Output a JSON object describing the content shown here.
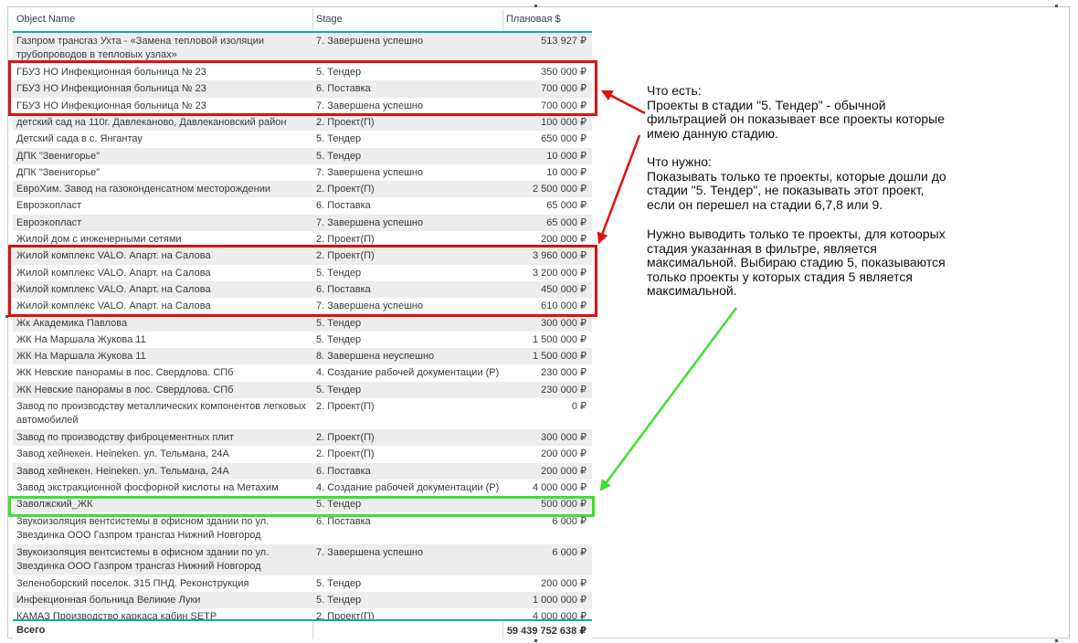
{
  "table": {
    "columns": [
      "Object Name",
      "Stage",
      "Плановая $"
    ],
    "rows": [
      {
        "name": "Газпром трансгаз Ухта - «Замена тепловой изоляции трубопроводов в тепловых узлах»",
        "stage": "7. Завершена успешно",
        "amount": "513 927 ₽"
      },
      {
        "name": "ГБУЗ НО Инфекционная больница № 23",
        "stage": "5. Тендер",
        "amount": "350 000 ₽"
      },
      {
        "name": "ГБУЗ НО Инфекционная больница № 23",
        "stage": "6. Поставка",
        "amount": "700 000 ₽"
      },
      {
        "name": "ГБУЗ НО Инфекционная больница № 23",
        "stage": "7. Завершена успешно",
        "amount": "700 000 ₽"
      },
      {
        "name": "детский сад на 110г. Давлеканово, Давлекановский район",
        "stage": "2. Проект(П)",
        "amount": "100 000 ₽"
      },
      {
        "name": "Детский сада в с. Янгантау",
        "stage": "5. Тендер",
        "amount": "650 000 ₽"
      },
      {
        "name": "ДПК \"Звенигорье\"",
        "stage": "5. Тендер",
        "amount": "10 000 ₽"
      },
      {
        "name": "ДПК \"Звенигорье\"",
        "stage": "7. Завершена успешно",
        "amount": "10 000 ₽"
      },
      {
        "name": "ЕвроХим. Завод на газоконденсатном месторождении",
        "stage": "2. Проект(П)",
        "amount": "2 500 000 ₽"
      },
      {
        "name": "Евроэкопласт",
        "stage": "6. Поставка",
        "amount": "65 000 ₽"
      },
      {
        "name": "Евроэкопласт",
        "stage": "7. Завершена успешно",
        "amount": "65 000 ₽"
      },
      {
        "name": "Жилой дом с инженерными сетями",
        "stage": "2. Проект(П)",
        "amount": "200 000 ₽"
      },
      {
        "name": "Жилой комплекс VALO. Апарт. на Салова",
        "stage": "2. Проект(П)",
        "amount": "3 960 000 ₽"
      },
      {
        "name": "Жилой комплекс VALO. Апарт. на Салова",
        "stage": "5. Тендер",
        "amount": "3 200 000 ₽"
      },
      {
        "name": "Жилой комплекс VALO. Апарт. на Салова",
        "stage": "6. Поставка",
        "amount": "450 000 ₽"
      },
      {
        "name": "Жилой комплекс VALO. Апарт. на Салова",
        "stage": "7. Завершена успешно",
        "amount": "610 000 ₽"
      },
      {
        "name": "Жк Академика Павлова",
        "stage": "5. Тендер",
        "amount": "300 000 ₽"
      },
      {
        "name": "ЖК На Маршала Жукова 11",
        "stage": "5. Тендер",
        "amount": "1 500 000 ₽"
      },
      {
        "name": "ЖК На Маршала Жукова 11",
        "stage": "8. Завершена неуспешно",
        "amount": "1 500 000 ₽"
      },
      {
        "name": "ЖК Невские панорамы в пос. Свердлова. СПб",
        "stage": "4. Создание рабочей документации (Р)",
        "amount": "230 000 ₽"
      },
      {
        "name": "ЖК Невские панорамы в пос. Свердлова. СПб",
        "stage": "5. Тендер",
        "amount": "230 000 ₽"
      },
      {
        "name": "Завод по производству металлических компонентов легковых автомобилей",
        "stage": "2. Проект(П)",
        "amount": "0 ₽"
      },
      {
        "name": "Завод по производству фиброцементных плит",
        "stage": "2. Проект(П)",
        "amount": "300 000 ₽"
      },
      {
        "name": "Завод хейнекен. Heineken. ул. Тельмана, 24А",
        "stage": "2. Проект(П)",
        "amount": "200 000 ₽"
      },
      {
        "name": "Завод хейнекен. Heineken. ул. Тельмана, 24А",
        "stage": "6. Поставка",
        "amount": "200 000 ₽"
      },
      {
        "name": "Завод экстракционной фосфорной кислоты на Метахим",
        "stage": "4. Создание рабочей документации (Р)",
        "amount": "4 000 000 ₽"
      },
      {
        "name": "Заволжский_ЖК",
        "stage": "5. Тендер",
        "amount": "500 000 ₽"
      },
      {
        "name": "Звукоизоляция вентсистемы в офисном здании по ул. Звездинка ООО Газпром трансгаз Нижний Новгород",
        "stage": "6. Поставка",
        "amount": "6 000 ₽"
      },
      {
        "name": "Звукоизоляция вентсистемы в офисном здании по ул. Звездинка ООО Газпром трансгаз Нижний Новгород",
        "stage": "7. Завершена успешно",
        "amount": "6 000 ₽"
      },
      {
        "name": "Зеленоборский поселок. 315 ПНД. Реконструкция",
        "stage": "5. Тендер",
        "amount": "200 000 ₽"
      },
      {
        "name": "Инфекционная больница Великие Луки",
        "stage": "5. Тендер",
        "amount": "1 000 000 ₽"
      },
      {
        "name": "КАМАЗ Производство каркаса кабин SETP",
        "stage": "2. Проект(П)",
        "amount": "4 000 000 ₽"
      }
    ],
    "total": {
      "label": "Всего",
      "value": "59 439 752 638 ₽"
    }
  },
  "annotations": {
    "line1": "Что есть:",
    "line2": "Проекты в стадии \"5. Тендер\" - обычной",
    "line3": "фильтрацией он показывает все проекты которые",
    "line4": "имею данную стадию.",
    "line5": "Что нужно:",
    "line6": "Показывать только те проекты, которые дошли до",
    "line7": "стадии \"5. Тендер\", не показывать этот проект,",
    "line8": "если он перешел на стадии 6,7,8 или 9.",
    "line9": "Нужно выводить только те проекты, для котоорых",
    "line10": "стадия указанная в фильтре, является",
    "line11": "максимальной. Выбираю стадию 5, показываются",
    "line12": "только проекты у которых стадия 5 является",
    "line13": "максимальной."
  },
  "colors": {
    "highlight_red": "#e01010",
    "highlight_green": "#3ee02f",
    "header_accent": "#00b0b0"
  }
}
